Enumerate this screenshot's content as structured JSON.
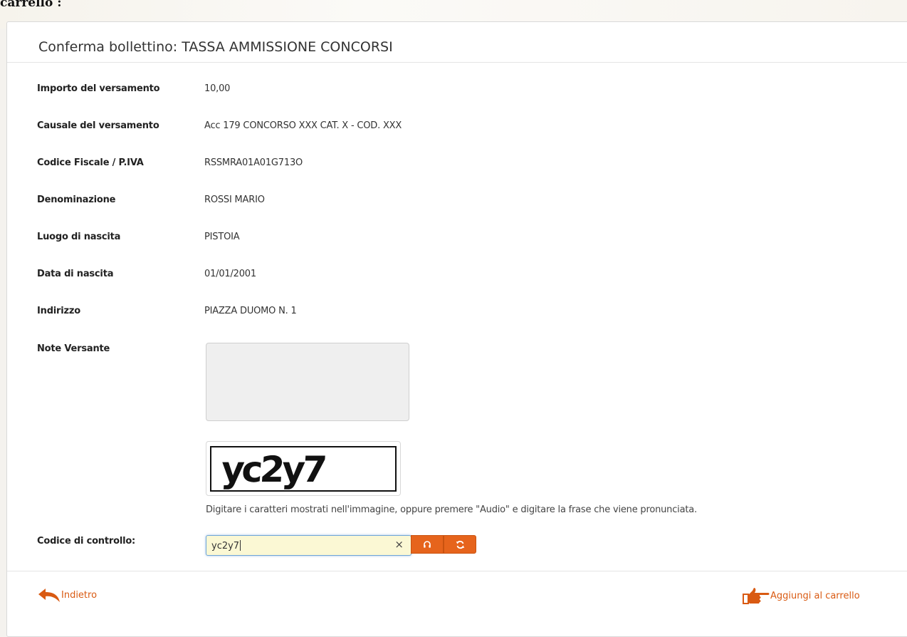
{
  "page": {
    "heading": "carrello :",
    "panel_title": "Conferma bollettino: TASSA AMMISSIONE CONCORSI"
  },
  "fields": [
    {
      "label": "Importo del versamento",
      "value": "10,00"
    },
    {
      "label": "Causale del versamento",
      "value": "Acc 179 CONCORSO XXX CAT. X - COD. XXX"
    },
    {
      "label": "Codice Fiscale / P.IVA",
      "value": "RSSMRA01A01G713O"
    },
    {
      "label": "Denominazione",
      "value": "ROSSI MARIO"
    },
    {
      "label": "Luogo di nascita",
      "value": "PISTOIA"
    },
    {
      "label": "Data di nascita",
      "value": "01/01/2001"
    },
    {
      "label": "Indirizzo",
      "value": "PIAZZA DUOMO N. 1"
    }
  ],
  "notes": {
    "label": "Note Versante",
    "value": ""
  },
  "captcha": {
    "image_text": "yc2y7",
    "help": "Digitare i caratteri mostrati nell'immagine, oppure premere \"Audio\" e digitare la frase che viene pronunciata.",
    "input_label": "Codice di controllo:",
    "input_value": "yc2y7",
    "clear_glyph": "×"
  },
  "actions": {
    "back_label": "Indietro",
    "add_to_cart_label": "Aggiungi al carrello"
  },
  "icons": {
    "back": "reply-arrow-icon",
    "add_to_cart": "hand-pointing-right-icon",
    "audio": "headphones-icon",
    "refresh": "refresh-icon"
  },
  "colors": {
    "accent": "#e6641c",
    "link": "#d95a12",
    "input_focus_bg": "#fbf8d4",
    "input_focus_border": "#6fa6d8"
  }
}
